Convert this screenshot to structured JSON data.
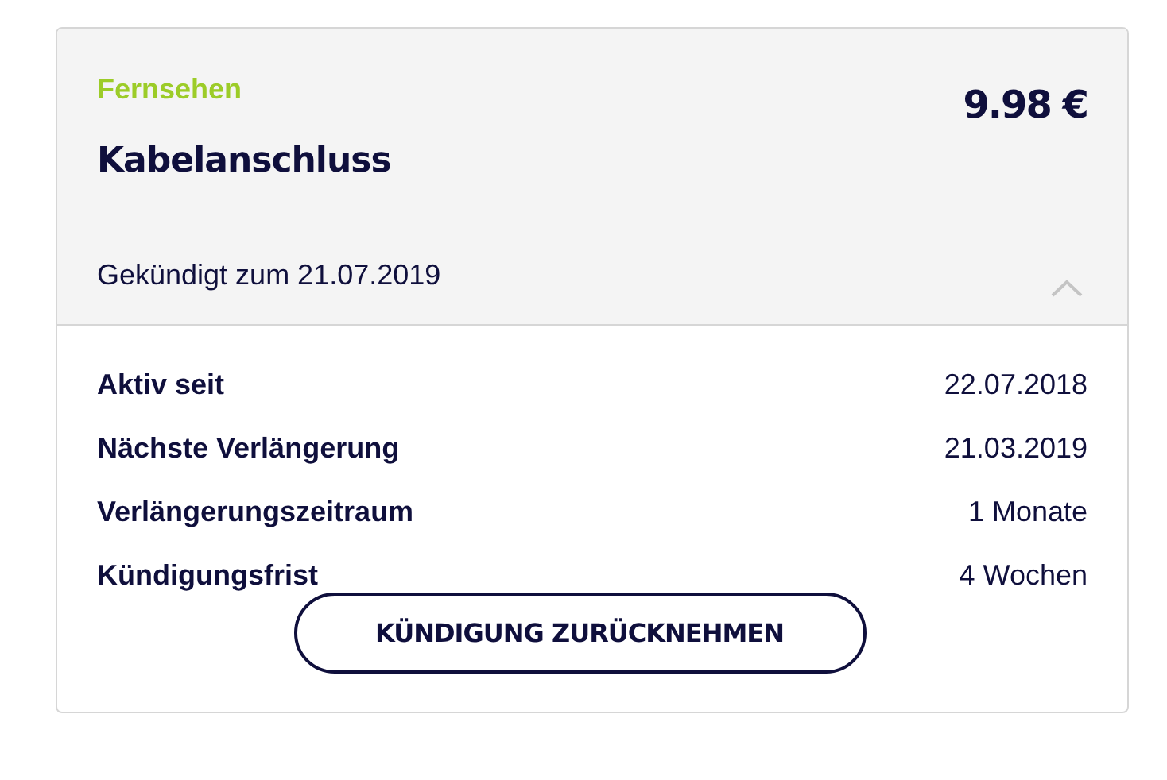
{
  "card": {
    "category": "Fernsehen",
    "title": "Kabelanschluss",
    "price": "9.98 €",
    "status": "Gekündigt zum 21.07.2019",
    "expanded": true,
    "details": [
      {
        "label": "Aktiv seit",
        "value": "22.07.2018"
      },
      {
        "label": "Nächste Verlängerung",
        "value": "21.03.2019"
      },
      {
        "label": "Verlängerungszeitraum",
        "value": "1 Monate"
      },
      {
        "label": "Kündigungsfrist",
        "value": "4 Wochen"
      }
    ],
    "button": "KÜNDIGUNG ZURÜCKNEHMEN"
  }
}
